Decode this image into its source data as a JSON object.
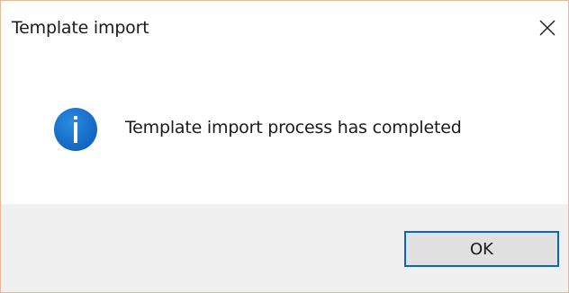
{
  "window": {
    "title": "Template import"
  },
  "message": {
    "text": "Template import process has completed",
    "icon": "info-icon"
  },
  "buttons": {
    "ok_label": "OK"
  },
  "colors": {
    "accent": "#0a64c8",
    "info_icon": "#1a73c8",
    "footer_bg": "#f0f0f0",
    "border": "#e8b89a"
  }
}
